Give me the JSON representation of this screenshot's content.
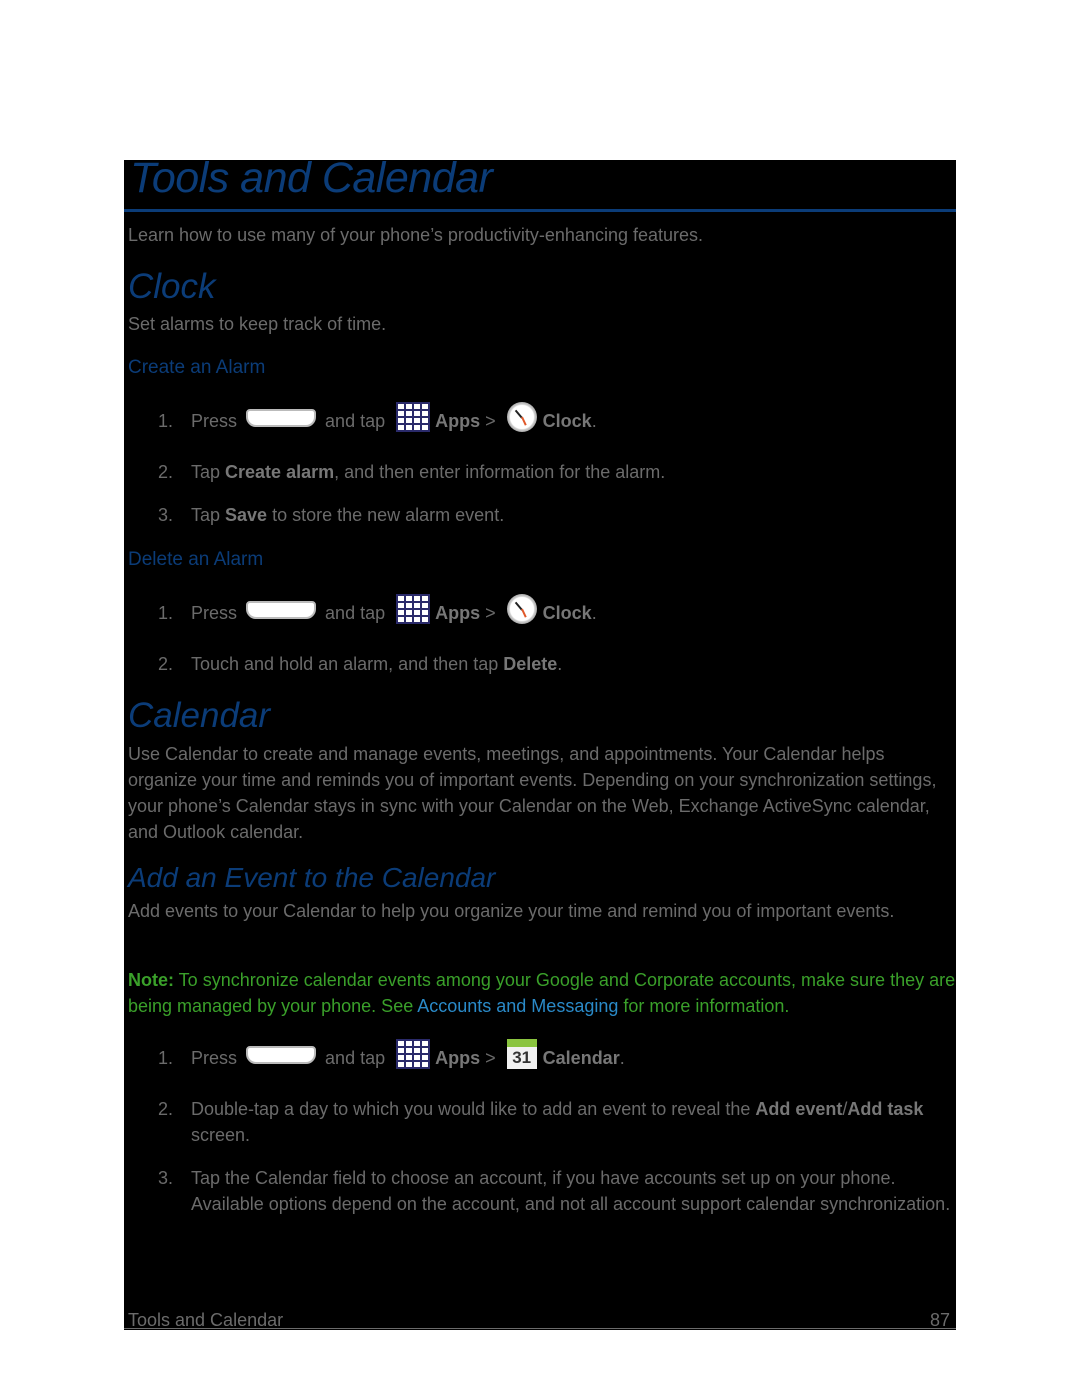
{
  "page": {
    "title": "Tools and Calendar",
    "intro": "Learn how to use many of your phone’s productivity-enhancing features.",
    "footer": {
      "section": "Tools and Calendar",
      "page_number": "87"
    }
  },
  "clock": {
    "heading": "Clock",
    "description": "Set alarms to keep track of time.",
    "create": {
      "heading": "Create an Alarm",
      "steps": [
        {
          "num": "1.",
          "press": "Press",
          "and_tap": "and tap",
          "apps": "Apps",
          "sep": ">",
          "target": "Clock",
          "end": "."
        },
        {
          "num": "2.",
          "pre": "Tap ",
          "bold": "Create alarm",
          "post": ", and then enter information for the alarm."
        },
        {
          "num": "3.",
          "pre": "Tap ",
          "bold": "Save",
          "post": " to store the new alarm event."
        }
      ]
    },
    "delete": {
      "heading": "Delete an Alarm",
      "steps": [
        {
          "num": "1.",
          "press": "Press",
          "and_tap": "and tap",
          "apps": "Apps",
          "sep": ">",
          "target": "Clock",
          "end": "."
        },
        {
          "num": "2.",
          "pre": "Touch and hold an alarm, and then tap ",
          "bold": "Delete",
          "post": "."
        }
      ]
    }
  },
  "calendar": {
    "heading": "Calendar",
    "description": "Use Calendar to create and manage events, meetings, and appointments. Your Calendar helps organize your time and reminds you of important events. Depending on your synchronization settings, your phone’s Calendar stays in sync with your Calendar on the Web, Exchange ActiveSync calendar, and Outlook calendar.",
    "add_event": {
      "heading": "Add an Event to the Calendar",
      "description": "Add events to your Calendar to help you organize your time and remind you of important events.",
      "note": {
        "label": "Note:",
        "text_before": " To synchronize calendar events among your Google and Corporate accounts, make sure they are being managed by your phone. See ",
        "link": "Accounts and Messaging",
        "text_after": " for more information."
      },
      "steps": [
        {
          "num": "1.",
          "press": "Press",
          "and_tap": "and tap",
          "apps": "Apps",
          "sep": ">",
          "target": "Calendar",
          "end": ".",
          "icon_day": "31"
        },
        {
          "num": "2.",
          "pre": "Double-tap a day to which you would like to add an event to reveal the ",
          "bold": "Add event",
          "mid": "/",
          "bold2": "Add task",
          "post": " screen."
        },
        {
          "num": "3.",
          "pre": "Tap the Calendar field to choose an account, if you have accounts set up on your phone. Available options depend on the account, and not all account support calendar synchronization."
        }
      ]
    }
  },
  "colors": {
    "heading": "#0b3c78",
    "body_text": "#6b6b6b",
    "note": "#3aa02a",
    "link": "#2a8ac8",
    "background": "#000000"
  }
}
